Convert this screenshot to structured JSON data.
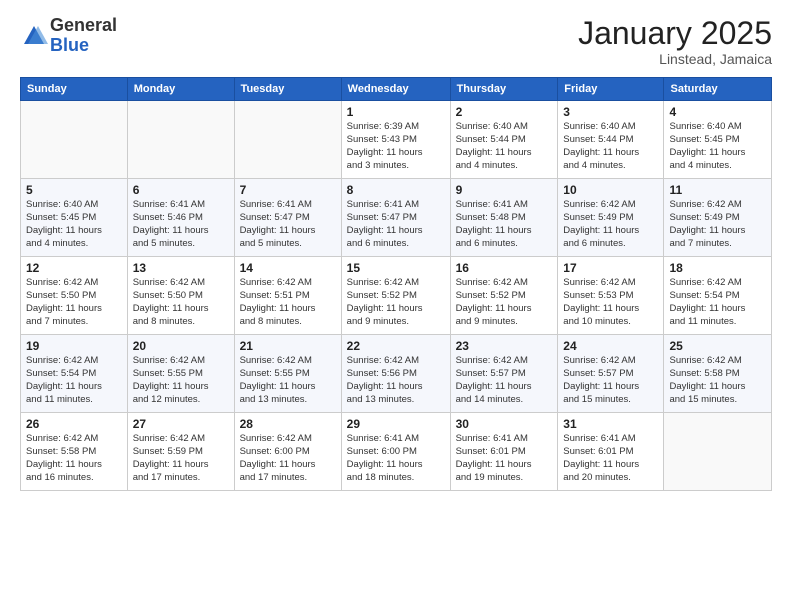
{
  "logo": {
    "general": "General",
    "blue": "Blue"
  },
  "header": {
    "month": "January 2025",
    "location": "Linstead, Jamaica"
  },
  "weekdays": [
    "Sunday",
    "Monday",
    "Tuesday",
    "Wednesday",
    "Thursday",
    "Friday",
    "Saturday"
  ],
  "weeks": [
    [
      {
        "day": "",
        "info": ""
      },
      {
        "day": "",
        "info": ""
      },
      {
        "day": "",
        "info": ""
      },
      {
        "day": "1",
        "info": "Sunrise: 6:39 AM\nSunset: 5:43 PM\nDaylight: 11 hours\nand 3 minutes."
      },
      {
        "day": "2",
        "info": "Sunrise: 6:40 AM\nSunset: 5:44 PM\nDaylight: 11 hours\nand 4 minutes."
      },
      {
        "day": "3",
        "info": "Sunrise: 6:40 AM\nSunset: 5:44 PM\nDaylight: 11 hours\nand 4 minutes."
      },
      {
        "day": "4",
        "info": "Sunrise: 6:40 AM\nSunset: 5:45 PM\nDaylight: 11 hours\nand 4 minutes."
      }
    ],
    [
      {
        "day": "5",
        "info": "Sunrise: 6:40 AM\nSunset: 5:45 PM\nDaylight: 11 hours\nand 4 minutes."
      },
      {
        "day": "6",
        "info": "Sunrise: 6:41 AM\nSunset: 5:46 PM\nDaylight: 11 hours\nand 5 minutes."
      },
      {
        "day": "7",
        "info": "Sunrise: 6:41 AM\nSunset: 5:47 PM\nDaylight: 11 hours\nand 5 minutes."
      },
      {
        "day": "8",
        "info": "Sunrise: 6:41 AM\nSunset: 5:47 PM\nDaylight: 11 hours\nand 6 minutes."
      },
      {
        "day": "9",
        "info": "Sunrise: 6:41 AM\nSunset: 5:48 PM\nDaylight: 11 hours\nand 6 minutes."
      },
      {
        "day": "10",
        "info": "Sunrise: 6:42 AM\nSunset: 5:49 PM\nDaylight: 11 hours\nand 6 minutes."
      },
      {
        "day": "11",
        "info": "Sunrise: 6:42 AM\nSunset: 5:49 PM\nDaylight: 11 hours\nand 7 minutes."
      }
    ],
    [
      {
        "day": "12",
        "info": "Sunrise: 6:42 AM\nSunset: 5:50 PM\nDaylight: 11 hours\nand 7 minutes."
      },
      {
        "day": "13",
        "info": "Sunrise: 6:42 AM\nSunset: 5:50 PM\nDaylight: 11 hours\nand 8 minutes."
      },
      {
        "day": "14",
        "info": "Sunrise: 6:42 AM\nSunset: 5:51 PM\nDaylight: 11 hours\nand 8 minutes."
      },
      {
        "day": "15",
        "info": "Sunrise: 6:42 AM\nSunset: 5:52 PM\nDaylight: 11 hours\nand 9 minutes."
      },
      {
        "day": "16",
        "info": "Sunrise: 6:42 AM\nSunset: 5:52 PM\nDaylight: 11 hours\nand 9 minutes."
      },
      {
        "day": "17",
        "info": "Sunrise: 6:42 AM\nSunset: 5:53 PM\nDaylight: 11 hours\nand 10 minutes."
      },
      {
        "day": "18",
        "info": "Sunrise: 6:42 AM\nSunset: 5:54 PM\nDaylight: 11 hours\nand 11 minutes."
      }
    ],
    [
      {
        "day": "19",
        "info": "Sunrise: 6:42 AM\nSunset: 5:54 PM\nDaylight: 11 hours\nand 11 minutes."
      },
      {
        "day": "20",
        "info": "Sunrise: 6:42 AM\nSunset: 5:55 PM\nDaylight: 11 hours\nand 12 minutes."
      },
      {
        "day": "21",
        "info": "Sunrise: 6:42 AM\nSunset: 5:55 PM\nDaylight: 11 hours\nand 13 minutes."
      },
      {
        "day": "22",
        "info": "Sunrise: 6:42 AM\nSunset: 5:56 PM\nDaylight: 11 hours\nand 13 minutes."
      },
      {
        "day": "23",
        "info": "Sunrise: 6:42 AM\nSunset: 5:57 PM\nDaylight: 11 hours\nand 14 minutes."
      },
      {
        "day": "24",
        "info": "Sunrise: 6:42 AM\nSunset: 5:57 PM\nDaylight: 11 hours\nand 15 minutes."
      },
      {
        "day": "25",
        "info": "Sunrise: 6:42 AM\nSunset: 5:58 PM\nDaylight: 11 hours\nand 15 minutes."
      }
    ],
    [
      {
        "day": "26",
        "info": "Sunrise: 6:42 AM\nSunset: 5:58 PM\nDaylight: 11 hours\nand 16 minutes."
      },
      {
        "day": "27",
        "info": "Sunrise: 6:42 AM\nSunset: 5:59 PM\nDaylight: 11 hours\nand 17 minutes."
      },
      {
        "day": "28",
        "info": "Sunrise: 6:42 AM\nSunset: 6:00 PM\nDaylight: 11 hours\nand 17 minutes."
      },
      {
        "day": "29",
        "info": "Sunrise: 6:41 AM\nSunset: 6:00 PM\nDaylight: 11 hours\nand 18 minutes."
      },
      {
        "day": "30",
        "info": "Sunrise: 6:41 AM\nSunset: 6:01 PM\nDaylight: 11 hours\nand 19 minutes."
      },
      {
        "day": "31",
        "info": "Sunrise: 6:41 AM\nSunset: 6:01 PM\nDaylight: 11 hours\nand 20 minutes."
      },
      {
        "day": "",
        "info": ""
      }
    ]
  ]
}
